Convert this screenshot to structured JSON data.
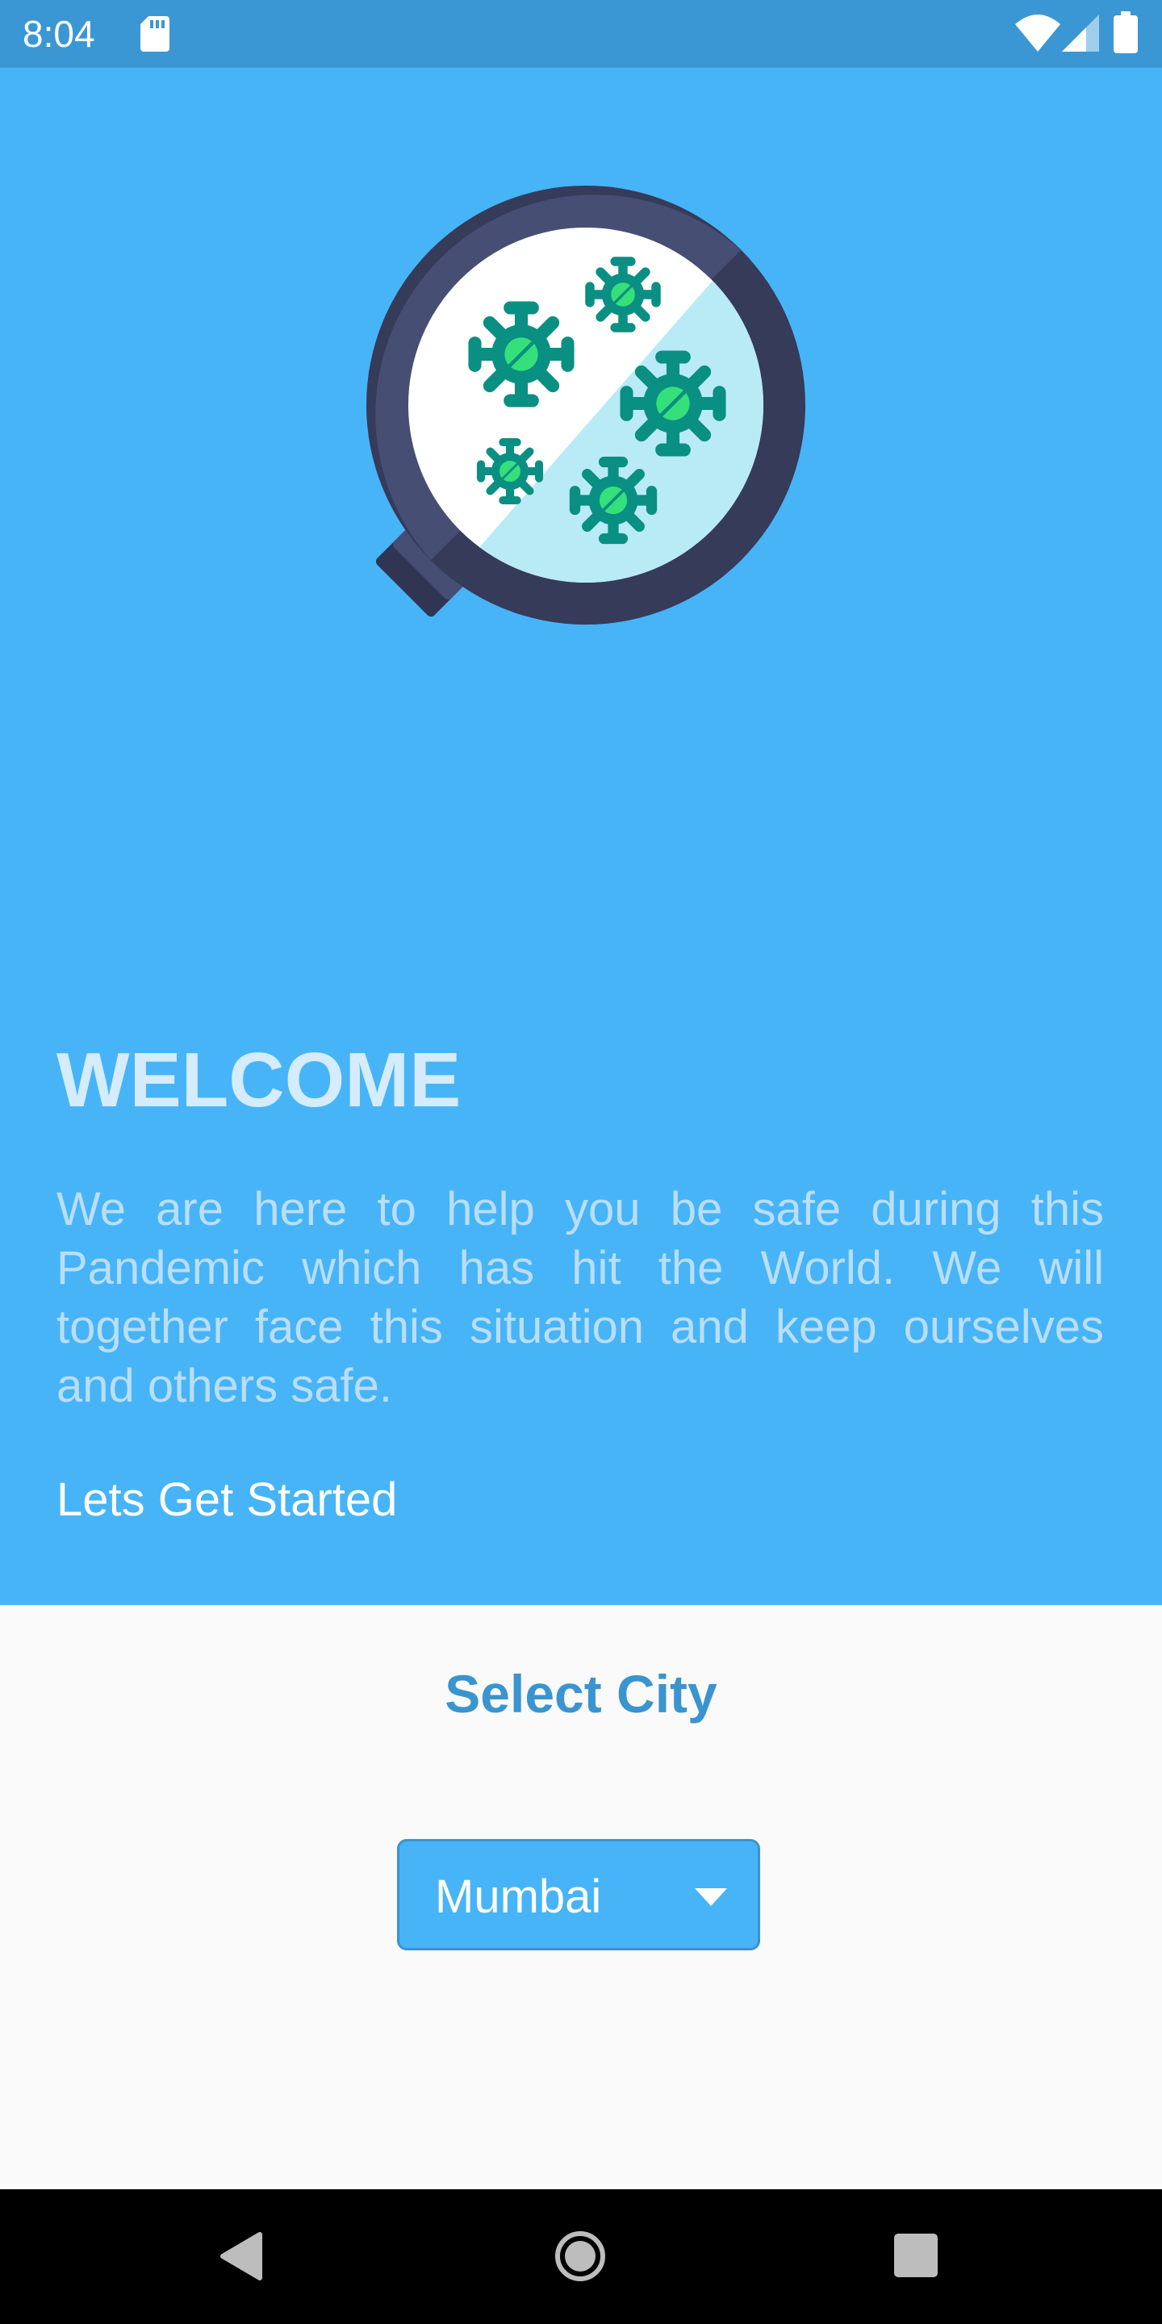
{
  "status_bar": {
    "time": "8:04",
    "icons": [
      "sd-card-icon",
      "wifi-icon",
      "signal-icon",
      "battery-icon"
    ]
  },
  "hero": {
    "illustration": "virus-magnifier-icon",
    "title": "WELCOME",
    "body": "We are here to help you be safe during this Pandemic which has hit the World. We will together face this situation and keep ourselves and others safe.",
    "cta": "Lets Get Started"
  },
  "city_select": {
    "title": "Select City",
    "selected": "Mumbai",
    "arrow_icon": "dropdown-arrow-icon"
  },
  "nav_bar": {
    "icons": [
      "back-icon",
      "home-icon",
      "recents-icon"
    ]
  },
  "colors": {
    "status_bar": "#3b97d3",
    "hero_background": "#47b4f7",
    "page_background": "#fafafa",
    "accent": "#3a94cf",
    "nav_bar": "#000000"
  }
}
